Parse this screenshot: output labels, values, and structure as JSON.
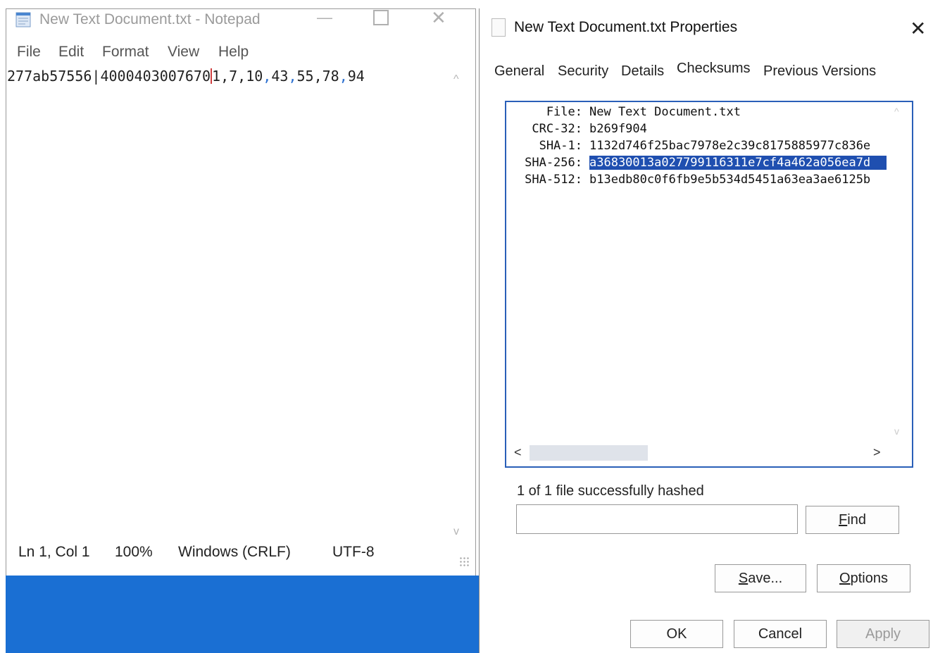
{
  "notepad": {
    "title": "New Text Document.txt - Notepad",
    "menu": [
      "File",
      "Edit",
      "Format",
      "View",
      "Help"
    ],
    "content": {
      "part1": "277ab57556",
      "sep1": "|",
      "part2": "4000403007670",
      "part3": "1",
      "c1": ",",
      "n1": "7",
      "c2": ",",
      "n2": "10",
      "c3": ",",
      "n3": "43",
      "c4": ",",
      "n4": "55",
      "c5": ",",
      "n5": "78",
      "c6": ",",
      "n6": "94"
    },
    "status": {
      "position": "Ln 1, Col 1",
      "zoom": "100%",
      "line_ending": "Windows (CRLF)",
      "encoding": "UTF-8"
    }
  },
  "properties": {
    "title": "New Text Document.txt Properties",
    "tabs": [
      "General",
      "Security",
      "Details",
      "Checksums",
      "Previous Versions"
    ],
    "active_tab": "Checksums",
    "hashes": [
      {
        "label": "File:",
        "value": "New Text Document.txt"
      },
      {
        "label": "CRC-32:",
        "value": "b269f904"
      },
      {
        "label": "SHA-1:",
        "value": "1132d746f25bac7978e2c39c8175885977c836e"
      },
      {
        "label": "SHA-256:",
        "value": "a36830013a027799116311e7cf4a462a056ea7d"
      },
      {
        "label": "SHA-512:",
        "value": "b13edb80c0f6fb9e5b534d5451a63ea3ae6125b"
      }
    ],
    "status_message": "1 of 1 file successfully hashed",
    "find_input_value": "",
    "buttons": {
      "find": {
        "mnemonic": "F",
        "rest": "ind"
      },
      "save": {
        "mnemonic": "S",
        "rest": "ave..."
      },
      "options": {
        "mnemonic": "O",
        "rest": "ptions"
      },
      "ok": "OK",
      "cancel": "Cancel",
      "apply": "Apply"
    }
  },
  "colors": {
    "selection": "#1f4fb0",
    "desktop": "#1a6fd3",
    "panel_border": "#2a5fb8"
  }
}
